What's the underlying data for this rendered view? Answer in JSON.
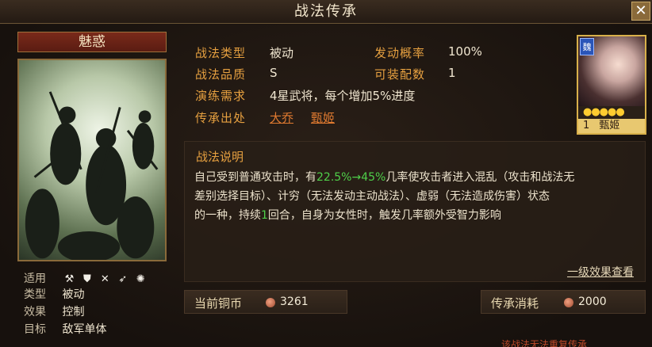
{
  "window": {
    "title": "战法传承",
    "close_label": "✕"
  },
  "skill": {
    "name": "魅惑",
    "meta": [
      {
        "label": "适用",
        "icons": [
          "axe-icon",
          "shield-icon",
          "crossbow-icon",
          "spear-icon",
          "wheel-icon"
        ]
      },
      {
        "label": "类型",
        "value": "被动"
      },
      {
        "label": "效果",
        "value": "控制"
      },
      {
        "label": "目标",
        "value": "敌军单体"
      }
    ]
  },
  "info": {
    "type_label": "战法类型",
    "type_value": "被动",
    "rate_label": "发动概率",
    "rate_value": "100%",
    "quality_label": "战法品质",
    "quality_value": "S",
    "equip_label": "可装配数",
    "equip_value": "1",
    "train_label": "演练需求",
    "train_value": "4星武将，每个增加5%进度",
    "source_label": "传承出处",
    "source_1": "大乔",
    "source_2": "甄姬"
  },
  "general": {
    "faction": "魏",
    "stars": "●●●●●",
    "level": "1",
    "name": "甄姬"
  },
  "description": {
    "title": "战法说明",
    "line1_a": "自己受到普通攻击时，有",
    "line1_hl": "22.5%→45%",
    "line1_b": "几率使攻击者进入混乱（攻击和战法无",
    "line2": "差别选择目标）、计穷（无法发动主动战法）、虚弱（无法造成伤害）状态",
    "line3_a": "的一种，持续",
    "line3_hl": "1",
    "line3_b": "回合，自身为女性时，触发几率额外受智力影响",
    "view_link": "一级效果查看"
  },
  "costs": {
    "current_label": "当前铜币",
    "current_value": "3261",
    "consume_label": "传承消耗",
    "consume_value": "2000"
  },
  "footer_note": "该战法无法重复传承",
  "colors": {
    "accent": "#e6a040",
    "highlight": "#4fd04a",
    "link": "#e07a30"
  }
}
